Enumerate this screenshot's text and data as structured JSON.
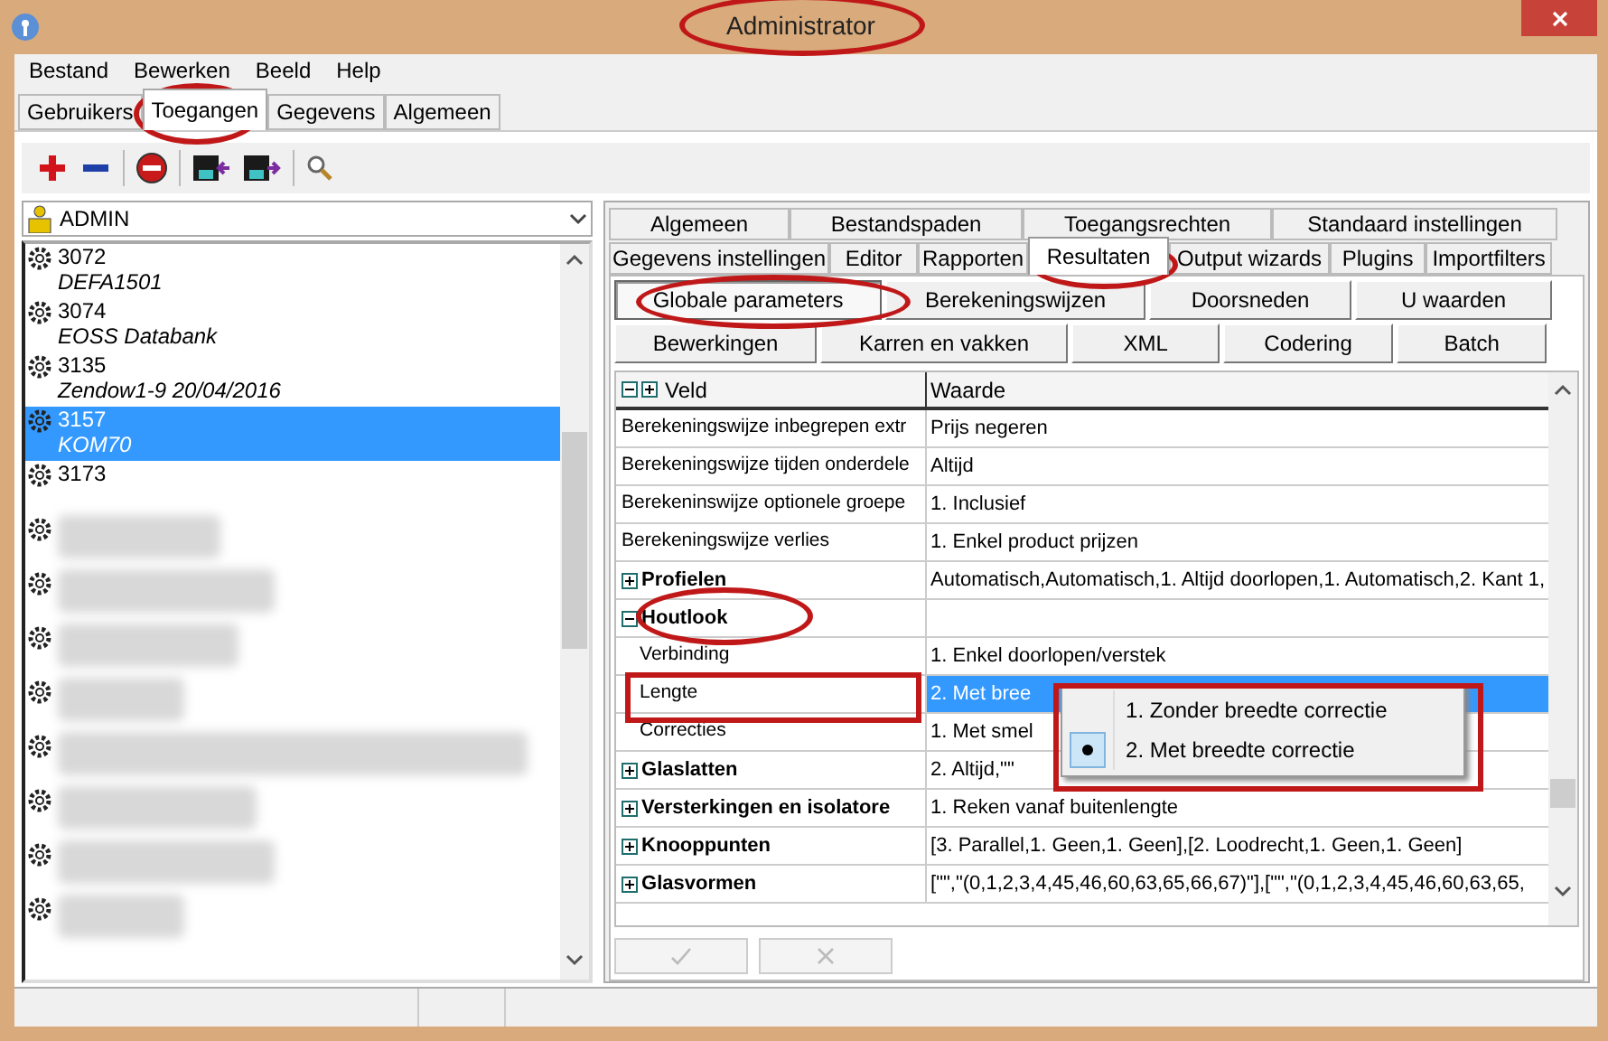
{
  "window": {
    "title": "Administrator"
  },
  "menu": [
    "Bestand",
    "Bewerken",
    "Beeld",
    "Help"
  ],
  "tabs": [
    {
      "label": "Gebruikers",
      "selected": false
    },
    {
      "label": "Toegangen",
      "selected": true
    },
    {
      "label": "Gegevens",
      "selected": false
    },
    {
      "label": "Algemeen",
      "selected": false
    }
  ],
  "user_select": {
    "value": "ADMIN"
  },
  "entries": [
    {
      "code": "3072",
      "name": "DEFA1501",
      "selected": false
    },
    {
      "code": "3074",
      "name": "EOSS Databank",
      "selected": false
    },
    {
      "code": "3135",
      "name": "Zendow1-9 20/04/2016",
      "selected": false
    },
    {
      "code": "3157",
      "name": "KOM70",
      "selected": true
    },
    {
      "code": "3173",
      "selected": false
    }
  ],
  "settings_tabs": [
    [
      {
        "label": "Algemeen",
        "selected": false
      },
      {
        "label": "Bestandspaden",
        "selected": false
      },
      {
        "label": "Toegangsrechten",
        "selected": false
      },
      {
        "label": "Standaard instellingen",
        "selected": false
      }
    ],
    [
      {
        "label": "Gegevens instellingen",
        "selected": false
      },
      {
        "label": "Editor",
        "selected": false
      },
      {
        "label": "Rapporten",
        "selected": false
      },
      {
        "label": "Resultaten",
        "selected": true
      },
      {
        "label": "Output wizards",
        "selected": false
      },
      {
        "label": "Plugins",
        "selected": false
      },
      {
        "label": "Importfilters",
        "selected": false
      }
    ]
  ],
  "section_buttons": [
    [
      {
        "label": "Globale parameters",
        "selected": true
      },
      {
        "label": "Berekeningswijzen",
        "selected": false
      },
      {
        "label": "Doorsneden",
        "selected": false
      },
      {
        "label": "U waarden",
        "selected": false
      }
    ],
    [
      {
        "label": "Bewerkingen",
        "selected": false
      },
      {
        "label": "Karren en vakken",
        "selected": false
      },
      {
        "label": "XML",
        "selected": false
      },
      {
        "label": "Codering",
        "selected": false
      },
      {
        "label": "Batch",
        "selected": false
      }
    ]
  ],
  "grid": {
    "columns": [
      "Veld",
      "Waarde"
    ],
    "rows": [
      {
        "kind": "property",
        "field": "Berekeningswijze inbegrepen extr",
        "value": "Prijs negeren",
        "selected": false
      },
      {
        "kind": "property",
        "field": "Berekeningswijze tijden onderdele",
        "value": "Altijd",
        "selected": false
      },
      {
        "kind": "property",
        "field": "Berekeninswijze optionele groepe",
        "value": "1. Inclusief",
        "selected": false
      },
      {
        "kind": "property",
        "field": "Berekeningswijze verlies",
        "value": "1. Enkel product prijzen",
        "selected": false
      },
      {
        "kind": "group",
        "field": "Profielen",
        "value": "Automatisch,Automatisch,1. Altijd doorlopen,1. Automatisch,2. Kant 1,",
        "expanded": false,
        "selected": false
      },
      {
        "kind": "group",
        "field": "Houtlook",
        "expanded": true,
        "selected": false
      },
      {
        "kind": "property",
        "field": "Verbinding",
        "value": "1. Enkel doorlopen/verstek",
        "selected": false
      },
      {
        "kind": "property",
        "field": "Lengte",
        "value": "2. Met bree",
        "selected": true
      },
      {
        "kind": "property",
        "field": "Correcties",
        "value": "1. Met smel",
        "selected": false
      },
      {
        "kind": "group",
        "field": "Glaslatten",
        "value": "2. Altijd,\"\"",
        "expanded": false,
        "selected": false
      },
      {
        "kind": "group",
        "field": "Versterkingen en isolatore",
        "value": "1. Reken vanaf buitenlengte",
        "expanded": false,
        "selected": false
      },
      {
        "kind": "group",
        "field": "Knooppunten",
        "value": "[3. Parallel,1. Geen,1. Geen],[2. Loodrecht,1. Geen,1. Geen]",
        "expanded": false,
        "selected": false
      },
      {
        "kind": "group",
        "field": "Glasvormen",
        "value": "[\"\",\"(0,1,2,3,4,45,46,60,63,65,66,67)\"],[\"\",\"(0,1,2,3,4,45,46,60,63,65,",
        "expanded": false,
        "selected": false
      }
    ]
  },
  "dropdown": [
    {
      "label": "1. Zonder breedte correctie",
      "selected": false
    },
    {
      "label": "2. Met breedte correctie",
      "selected": true
    }
  ]
}
